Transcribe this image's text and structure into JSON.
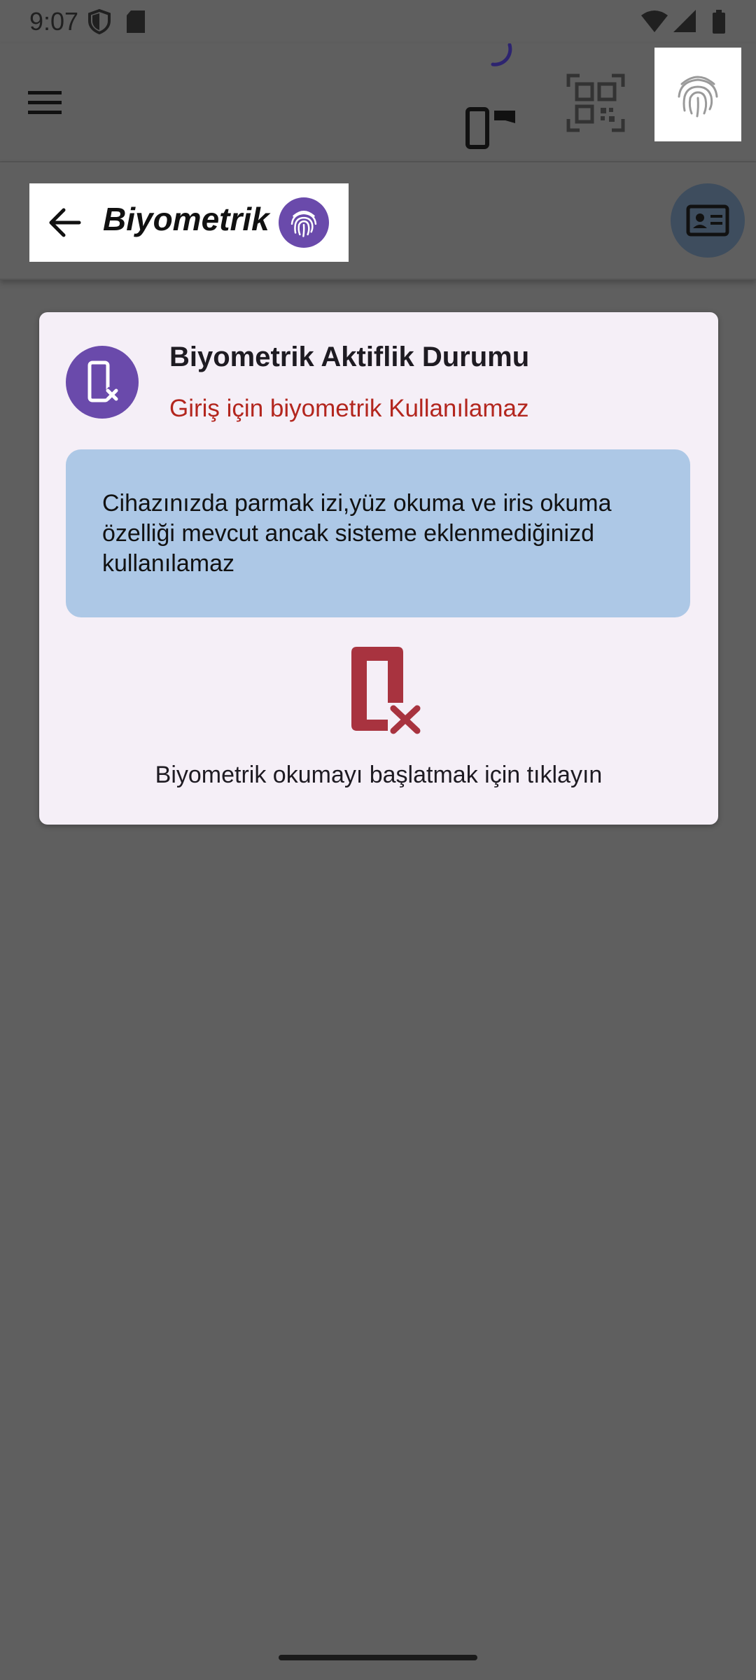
{
  "status_bar": {
    "time": "9:07",
    "icons": [
      "shield-icon",
      "sd-card-icon",
      "wifi-icon",
      "signal-icon",
      "battery-icon"
    ]
  },
  "app_bar": {
    "icons": [
      "menu-icon",
      "loading-spinner-icon",
      "mobile-device-icon",
      "qr-code-icon",
      "fingerprint-icon"
    ]
  },
  "sub_bar": {
    "title": "Biyometrik",
    "icons": [
      "back-arrow-icon",
      "fingerprint-icon",
      "id-card-icon"
    ]
  },
  "card": {
    "title": "Biyometrik Aktiflik Durumu",
    "subtitle": "Giriş için biyometrik Kullanılamaz",
    "info": "Cihazınızda parmak izi,yüz okuma ve iris okuma özelliği mevcut ancak sisteme eklenmediğinizd kullanılamaz",
    "action": "Biyometrik okumayı başlatmak için tıklayın",
    "colors": {
      "accent": "#6a4aab",
      "error": "#b3261e",
      "info_bg": "#adc8e6",
      "card_bg": "#f5eff7"
    }
  }
}
